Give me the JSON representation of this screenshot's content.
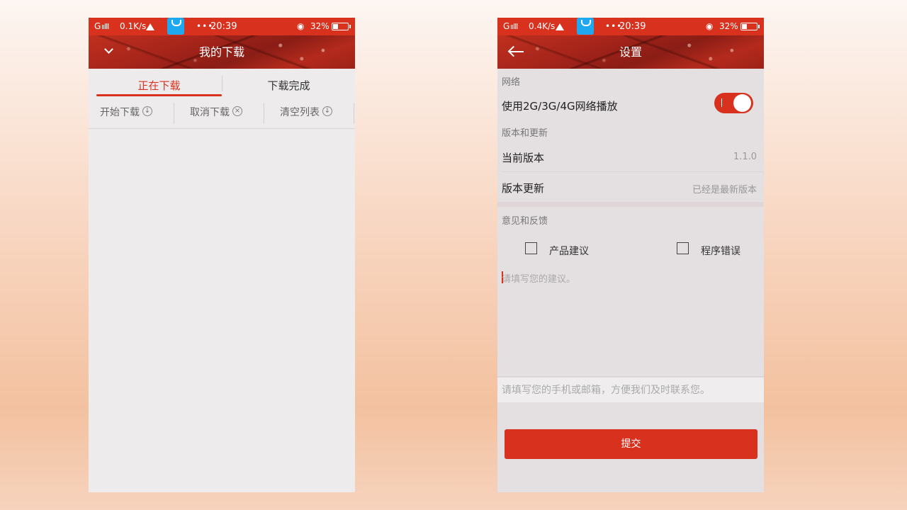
{
  "statusbar_left": {
    "network": "G",
    "speed": "0.1K/s",
    "time": "20:39",
    "dots": "•••",
    "wifi": "◉",
    "battery": "32%"
  },
  "statusbar_right": {
    "network": "G",
    "speed": "0.4K/s",
    "time": "20:39",
    "dots": "•••",
    "wifi": "◉",
    "battery": "32%"
  },
  "download_screen": {
    "title": "我的下载",
    "tabs": [
      {
        "label": "正在下载",
        "active": true
      },
      {
        "label": "下载完成",
        "active": false
      }
    ],
    "toolbar": {
      "start": "开始下载",
      "start_icon": "↓",
      "cancel": "取消下载",
      "cancel_icon": "×",
      "clear": "清空列表",
      "clear_icon": "↓"
    }
  },
  "settings_screen": {
    "title": "设置",
    "network_section": "网络",
    "network_toggle_label": "使用2G/3G/4G网络播放",
    "network_toggle_on": true,
    "version_section": "版本和更新",
    "current_version_label": "当前版本",
    "current_version_value": "1.1.0",
    "update_label": "版本更新",
    "update_value": "已经是最新版本",
    "feedback_section": "意见和反馈",
    "checkbox_product": "产品建议",
    "checkbox_bug": "程序错误",
    "feedback_placeholder": "请填写您的建议。",
    "contact_placeholder": "请填写您的手机或邮箱，方便我们及时联系您。",
    "submit": "提交"
  },
  "colors": {
    "accent": "#d8321f",
    "background_gradient_top": "#fdf6f2",
    "background_gradient_mid": "#f3c19f"
  }
}
